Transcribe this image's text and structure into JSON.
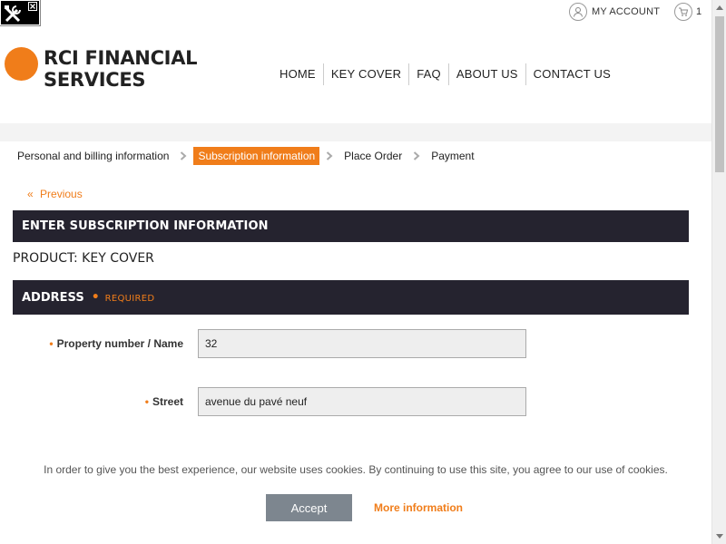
{
  "header": {
    "account_label": "MY ACCOUNT",
    "cart_count": "1",
    "logo_line1": "RCI FINANCIAL",
    "logo_line2": "SERVICES",
    "nav": [
      "HOME",
      "KEY COVER",
      "FAQ",
      "ABOUT US",
      "CONTACT US"
    ]
  },
  "steps": [
    "Personal and billing information",
    "Subscription information",
    "Place Order",
    "Payment"
  ],
  "previous_link": "Previous",
  "section_title": "ENTER SUBSCRIPTION INFORMATION",
  "product_line": "PRODUCT: KEY COVER",
  "address": {
    "title": "ADDRESS",
    "required_label": "REQUIRED",
    "fields": [
      {
        "label": "Property number / Name",
        "value": "32"
      },
      {
        "label": "Street",
        "value": "avenue du pavé neuf"
      }
    ]
  },
  "cookie": {
    "message": "In order to give you the best experience, our website uses cookies. By continuing to use this site, you agree to our use of cookies.",
    "accept_label": "Accept",
    "more_label": "More information"
  },
  "colors": {
    "accent": "#f07d1a",
    "dark_bar": "#25232f",
    "accept_button": "#7d868f"
  },
  "icons": [
    "tools-icon",
    "close-icon",
    "user-icon",
    "cart-icon",
    "chevron-right-icon",
    "double-chevron-left-icon",
    "scroll-up-icon",
    "scroll-down-icon"
  ]
}
